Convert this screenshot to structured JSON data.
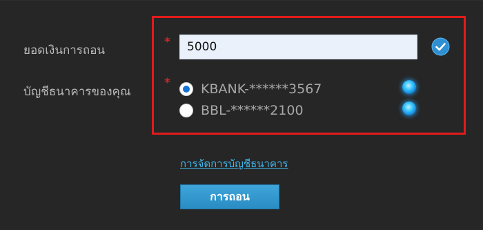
{
  "form": {
    "amount_label": "ยอดเงินการถอน",
    "account_label": "บัญชีธนาคารของคุณ",
    "required_mark": "*",
    "amount_value": "5000",
    "accounts": [
      {
        "label": "KBANK-******3567",
        "selected": true
      },
      {
        "label": "BBL-******2100",
        "selected": false
      }
    ]
  },
  "links": {
    "manage_accounts": "การจัดการบัญชีธนาคาร"
  },
  "actions": {
    "withdraw_label": "การถอน"
  },
  "icons": {
    "amount_status": "check-circle-icon",
    "account_status": "blue-glow-dot-icon"
  },
  "colors": {
    "highlight_border": "#e31b1b",
    "accent": "#2a8dc4",
    "link": "#40b4e8",
    "required": "#d62424"
  }
}
